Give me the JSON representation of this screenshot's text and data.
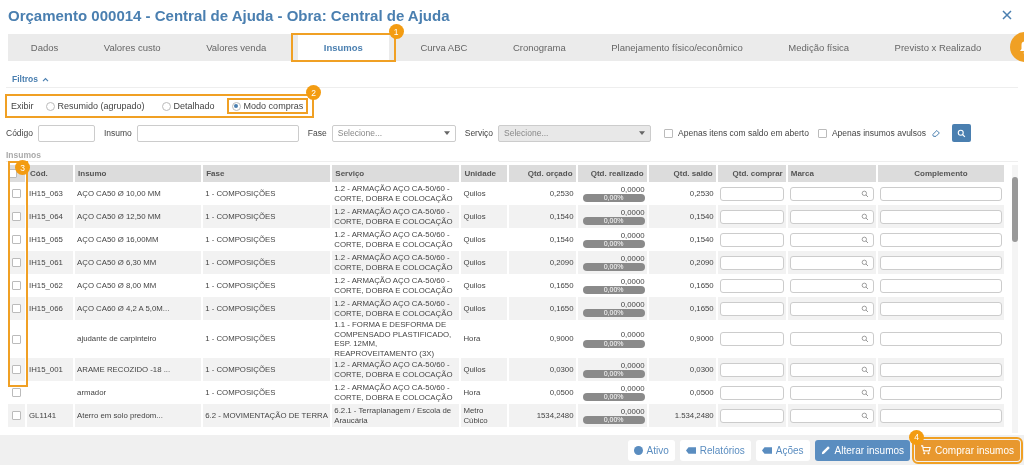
{
  "window": {
    "title": "Orçamento 000014 - Central de Ajuda - Obra: Central de Ajuda"
  },
  "tabs": [
    {
      "label": "Dados",
      "selected": false
    },
    {
      "label": "Valores custo",
      "selected": false
    },
    {
      "label": "Valores venda",
      "selected": false
    },
    {
      "label": "Insumos",
      "selected": true,
      "callout": "1"
    },
    {
      "label": "Curva ABC",
      "selected": false
    },
    {
      "label": "Cronograma",
      "selected": false
    },
    {
      "label": "Planejamento físico/econômico",
      "selected": false
    },
    {
      "label": "Medição física",
      "selected": false
    },
    {
      "label": "Previsto x Realizado",
      "selected": false
    }
  ],
  "filters": {
    "title": "Filtros",
    "expanded": true,
    "display": {
      "label": "Exibir",
      "callout": "2",
      "options": [
        {
          "label": "Resumido (agrupado)",
          "selected": false,
          "highlighted": false
        },
        {
          "label": "Detalhado",
          "selected": false,
          "highlighted": false
        },
        {
          "label": "Modo compras",
          "selected": true,
          "highlighted": true
        }
      ]
    },
    "fields": [
      {
        "kind": "input",
        "label": "Código",
        "wide": false
      },
      {
        "kind": "input",
        "label": "Insumo",
        "wide": true
      },
      {
        "kind": "select",
        "label": "Fase",
        "placeholder": "Selecione...",
        "disabled": false
      },
      {
        "kind": "select",
        "label": "Serviço",
        "placeholder": "Selecione...",
        "disabled": true
      }
    ],
    "checkboxes": [
      {
        "label": "Apenas itens com saldo em aberto",
        "checked": false
      },
      {
        "label": "Apenas insumos avulsos",
        "checked": false
      }
    ]
  },
  "table": {
    "title": "Insumos",
    "select_all_checked": false,
    "select_callout": "3",
    "columns": [
      "Cód.",
      "Insumo",
      "Fase",
      "Serviço",
      "Unidade",
      "Qtd. orçado",
      "Qtd. realizado",
      "Qtd. saldo",
      "Qtd. comprar",
      "Marca",
      "Complemento"
    ],
    "rows": [
      {
        "checked": false,
        "code": "IH15_063",
        "insumo": "AÇO CA50 Ø 10,00 MM",
        "fase": "1 - COMPOSIÇÕES",
        "servico": "1.2 - ARMAÇÃO AÇO CA-50/60 - CORTE, DOBRA E COLOCAÇÃO",
        "unidade": "Quilos",
        "orcado": "0,2530",
        "realizado": "0,0000",
        "percent": "0,00%",
        "level": 0,
        "saldo": "0,2530"
      },
      {
        "checked": false,
        "code": "IH15_064",
        "insumo": "AÇO CA50 Ø 12,50 MM",
        "fase": "1 - COMPOSIÇÕES",
        "servico": "1.2 - ARMAÇÃO AÇO CA-50/60 - CORTE, DOBRA E COLOCAÇÃO",
        "unidade": "Quilos",
        "orcado": "0,1540",
        "realizado": "0,0000",
        "percent": "0,00%",
        "level": 0,
        "saldo": "0,1540"
      },
      {
        "checked": false,
        "code": "IH15_065",
        "insumo": "AÇO CA50 Ø 16,00MM",
        "fase": "1 - COMPOSIÇÕES",
        "servico": "1.2 - ARMAÇÃO AÇO CA-50/60 - CORTE, DOBRA E COLOCAÇÃO",
        "unidade": "Quilos",
        "orcado": "0,1540",
        "realizado": "0,0000",
        "percent": "0,00%",
        "level": 0,
        "saldo": "0,1540"
      },
      {
        "checked": false,
        "code": "IH15_061",
        "insumo": "AÇO CA50 Ø 6,30 MM",
        "fase": "1 - COMPOSIÇÕES",
        "servico": "1.2 - ARMAÇÃO AÇO CA-50/60 - CORTE, DOBRA E COLOCAÇÃO",
        "unidade": "Quilos",
        "orcado": "0,2090",
        "realizado": "0,0000",
        "percent": "0,00%",
        "level": 0,
        "saldo": "0,2090"
      },
      {
        "checked": false,
        "code": "IH15_062",
        "insumo": "AÇO CA50 Ø 8,00 MM",
        "fase": "1 - COMPOSIÇÕES",
        "servico": "1.2 - ARMAÇÃO AÇO CA-50/60 - CORTE, DOBRA E COLOCAÇÃO",
        "unidade": "Quilos",
        "orcado": "0,1650",
        "realizado": "0,0000",
        "percent": "0,00%",
        "level": 0,
        "saldo": "0,1650"
      },
      {
        "checked": false,
        "code": "IH15_066",
        "insumo": "AÇO CA60 Ø 4,2 A 5,0M...",
        "fase": "1 - COMPOSIÇÕES",
        "servico": "1.2 - ARMAÇÃO AÇO CA-50/60 - CORTE, DOBRA E COLOCAÇÃO",
        "unidade": "Quilos",
        "orcado": "0,1650",
        "realizado": "0,0000",
        "percent": "0,00%",
        "level": 0,
        "saldo": "0,1650"
      },
      {
        "checked": false,
        "code": "",
        "insumo": "ajudante de carpinteiro",
        "fase": "1 - COMPOSIÇÕES",
        "servico": "1.1 - FORMA E DESFORMA DE COMPENSADO PLASTIFICADO, ESP. 12MM, REAPROVEITAMENTO (3X)",
        "unidade": "Hora",
        "orcado": "0,9000",
        "realizado": "0,0000",
        "percent": "0,00%",
        "level": 0,
        "saldo": "0,9000"
      },
      {
        "checked": false,
        "code": "IH15_001",
        "insumo": "ARAME RECOZIDO -18 ...",
        "fase": "1 - COMPOSIÇÕES",
        "servico": "1.2 - ARMAÇÃO AÇO CA-50/60 - CORTE, DOBRA E COLOCAÇÃO",
        "unidade": "Quilos",
        "orcado": "0,0300",
        "realizado": "0,0000",
        "percent": "0,00%",
        "level": 0,
        "saldo": "0,0300"
      },
      {
        "checked": false,
        "code": "",
        "insumo": "armador",
        "fase": "1 - COMPOSIÇÕES",
        "servico": "1.2 - ARMAÇÃO AÇO CA-50/60 - CORTE, DOBRA E COLOCAÇÃO",
        "unidade": "Hora",
        "orcado": "0,0500",
        "realizado": "0,0000",
        "percent": "0,00%",
        "level": 0,
        "saldo": "0,0500"
      },
      {
        "checked": false,
        "code": "GL1141",
        "insumo": "Aterro em solo predom...",
        "fase": "6.2 - MOVIMENTAÇÃO DE TERRA",
        "servico": "6.2.1 - Terraplanagem / Escola de Araucária",
        "unidade": "Metro Cúbico",
        "orcado": "1534,2480",
        "realizado": "0,0000",
        "percent": "0,00%",
        "level": 0,
        "saldo": "1.534,2480"
      }
    ]
  },
  "actions": [
    {
      "kind": "status",
      "label": "Ativo"
    },
    {
      "kind": "tag",
      "label": "Relatórios"
    },
    {
      "kind": "tag",
      "label": "Ações"
    },
    {
      "kind": "edit",
      "label": "Alterar insumos"
    },
    {
      "kind": "cart",
      "label": "Comprar insumos",
      "callout": "4"
    }
  ]
}
